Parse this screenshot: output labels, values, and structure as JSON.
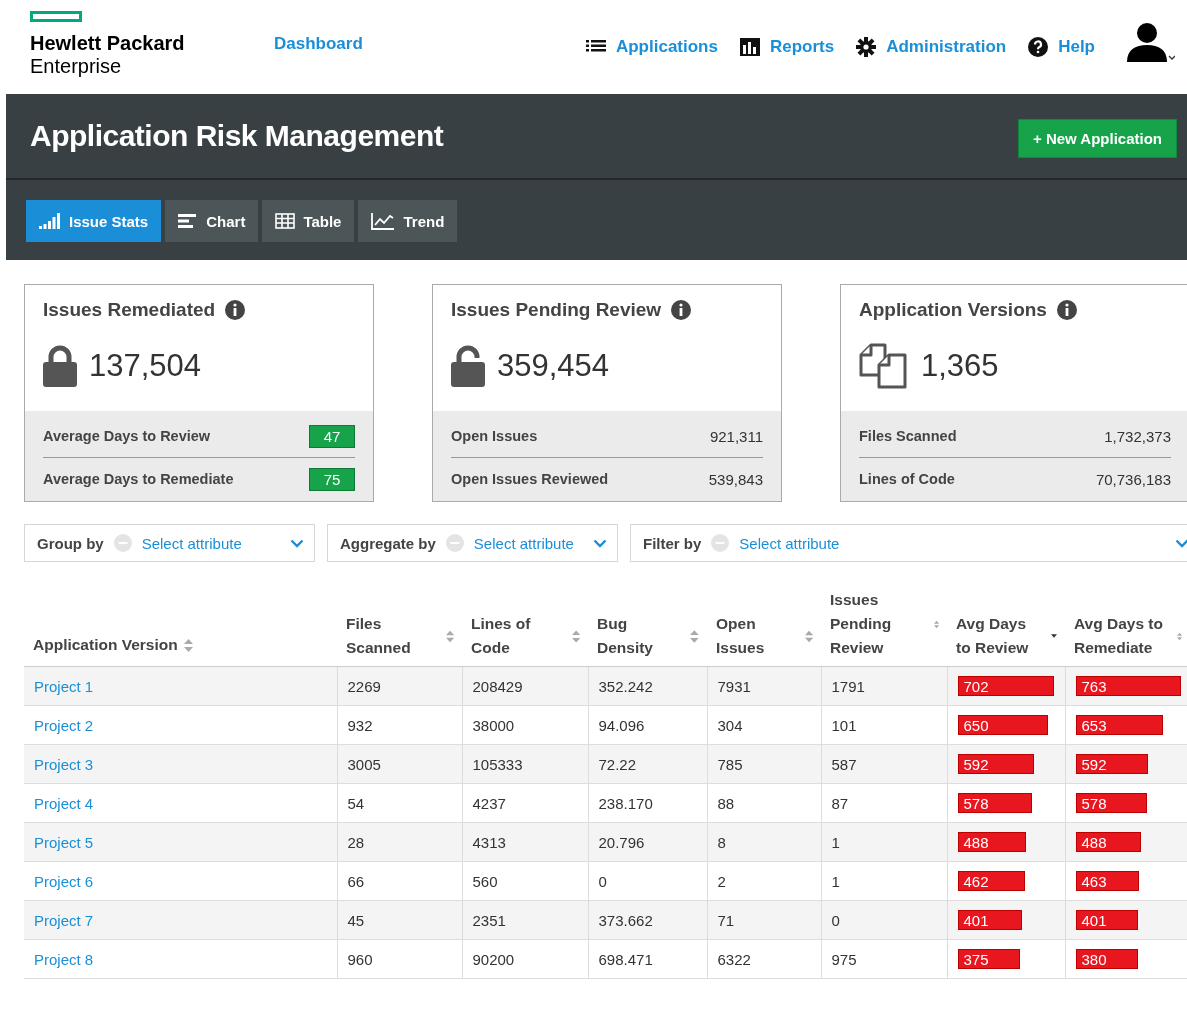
{
  "header": {
    "logo_line_1": "Hewlett Packard",
    "logo_line_2": "Enterprise",
    "dashboard_link": "Dashboard",
    "nav": [
      {
        "label": "Applications",
        "kind": "list"
      },
      {
        "label": "Reports",
        "kind": "bars"
      },
      {
        "label": "Administration",
        "kind": "gear"
      },
      {
        "label": "Help",
        "kind": "help"
      }
    ]
  },
  "title_bar": {
    "title": "Application Risk Management",
    "new_button": "+ New Application"
  },
  "tabs": [
    {
      "label": "Issue Stats",
      "kind": "stats",
      "selected": true
    },
    {
      "label": "Chart",
      "kind": "chart",
      "selected": false
    },
    {
      "label": "Table",
      "kind": "table",
      "selected": false
    },
    {
      "label": "Trend",
      "kind": "trend",
      "selected": false
    }
  ],
  "cards": [
    {
      "title": "Issues Remediated",
      "kind": "locked",
      "value": "137,504",
      "rows": [
        {
          "label": "Average Days to Review",
          "value": "47",
          "kind": "badge"
        },
        {
          "label": "Average Days to Remediate",
          "value": "75",
          "kind": "badge"
        }
      ]
    },
    {
      "title": "Issues Pending Review",
      "kind": "unlocked",
      "value": "359,454",
      "rows": [
        {
          "label": "Open Issues",
          "value": "921,311",
          "kind": "plain"
        },
        {
          "label": "Open Issues Reviewed",
          "value": "539,843",
          "kind": "plain"
        }
      ]
    },
    {
      "title": "Application Versions",
      "kind": "files",
      "value": "1,365",
      "rows": [
        {
          "label": "Files Scanned",
          "value": "1,732,373",
          "kind": "plain"
        },
        {
          "label": "Lines of Code",
          "value": "70,736,183",
          "kind": "plain"
        }
      ]
    }
  ],
  "filters": [
    {
      "label": "Group by",
      "placeholder": "Select attribute"
    },
    {
      "label": "Aggregate by",
      "placeholder": "Select attribute"
    },
    {
      "label": "Filter by",
      "placeholder": "Select attribute"
    }
  ],
  "table": {
    "columns": [
      {
        "label": "Application Version",
        "sorted": false
      },
      {
        "label": "Files Scanned",
        "sorted": false
      },
      {
        "label": "Lines of Code",
        "sorted": false
      },
      {
        "label": "Bug Density",
        "sorted": false
      },
      {
        "label": "Open Issues",
        "sorted": false
      },
      {
        "label": "Issues Pending Review",
        "sorted": false
      },
      {
        "label": "Avg Days to Review",
        "sorted": true
      },
      {
        "label": "Avg Days to Remediate",
        "sorted": false
      }
    ],
    "rows": [
      {
        "cells": [
          "Project 1",
          "2269",
          "208429",
          "352.242",
          "7931",
          "1791"
        ],
        "review": "702",
        "remediate": "763"
      },
      {
        "cells": [
          "Project 2",
          "932",
          "38000",
          "94.096",
          "304",
          "101"
        ],
        "review": "650",
        "remediate": "653"
      },
      {
        "cells": [
          "Project 3",
          "3005",
          "105333",
          "72.22",
          "785",
          "587"
        ],
        "review": "592",
        "remediate": "592"
      },
      {
        "cells": [
          "Project 4",
          "54",
          "4237",
          "238.170",
          "88",
          "87"
        ],
        "review": "578",
        "remediate": "578"
      },
      {
        "cells": [
          "Project 5",
          "28",
          "4313",
          "20.796",
          "8",
          "1"
        ],
        "review": "488",
        "remediate": "488"
      },
      {
        "cells": [
          "Project 6",
          "66",
          "560",
          "0",
          "2",
          "1"
        ],
        "review": "462",
        "remediate": "463"
      },
      {
        "cells": [
          "Project 7",
          "45",
          "2351",
          "373.662",
          "71",
          "0"
        ],
        "review": "401",
        "remediate": "401"
      },
      {
        "cells": [
          "Project 8",
          "960",
          "90200",
          "698.471",
          "6322",
          "975"
        ],
        "review": "375",
        "remediate": "380"
      }
    ]
  }
}
